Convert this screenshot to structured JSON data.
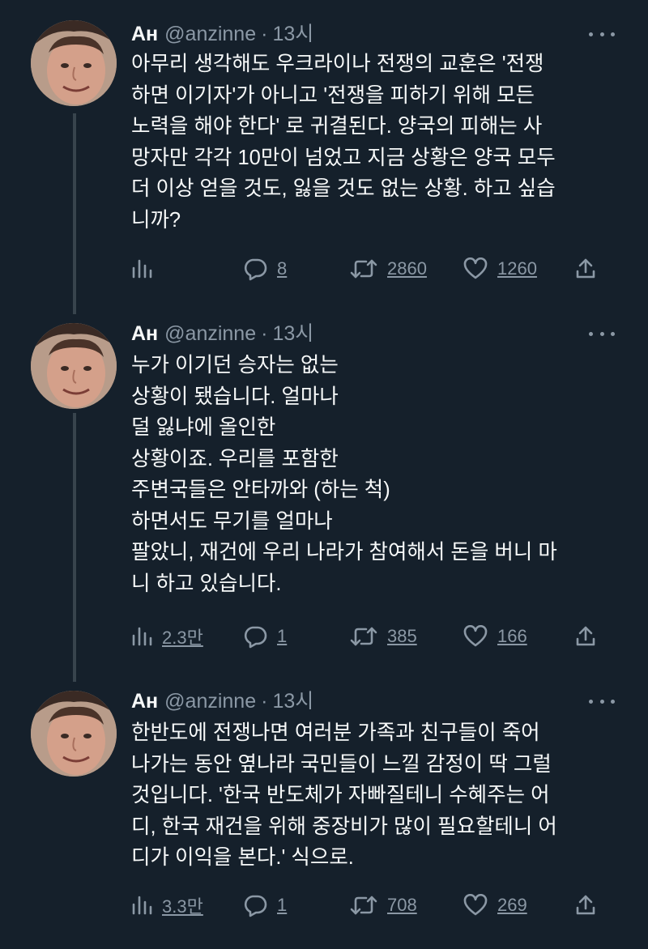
{
  "tweets": [
    {
      "name": "Ан",
      "handle": "@anzinne",
      "time": "13시",
      "text": "아무리 생각해도 우크라이나 전쟁의 교훈은 '전쟁\n하면 이기자'가 아니고 '전쟁을 피하기 위해 모든\n노력을 해야 한다' 로 귀결된다. 양국의 피해는 사\n망자만 각각 10만이 넘었고 지금 상황은 양국 모두\n더 이상 얻을 것도, 잃을 것도 없는 상황. 하고 싶습\n니까?",
      "views": "",
      "replies": "8",
      "retweets": "2860",
      "likes": "1260"
    },
    {
      "name": "Ан",
      "handle": "@anzinne",
      "time": "13시",
      "text": "누가 이기던 승자는 없는\n상황이 됐습니다. 얼마나\n덜 잃냐에 올인한\n상황이죠. 우리를 포함한\n주변국들은 안타까와 (하는 척)\n하면서도 무기를 얼마나\n팔았니, 재건에 우리 나라가 참여해서 돈을 버니 마\n니 하고 있습니다.",
      "views": "2.3만",
      "replies": "1",
      "retweets": "385",
      "likes": "166"
    },
    {
      "name": "Ан",
      "handle": "@anzinne",
      "time": "13시",
      "text": "한반도에 전쟁나면 여러분 가족과 친구들이 죽어\n나가는 동안 옆나라 국민들이 느낄 감정이 딱 그럴\n것입니다. '한국 반도체가 자빠질테니 수혜주는 어\n디, 한국 재건을 위해 중장비가 많이 필요할테니 어\n디가 이익을 본다.' 식으로.",
      "views": "3.3만",
      "replies": "1",
      "retweets": "708",
      "likes": "269"
    }
  ],
  "icons": {
    "views": "bar-chart-icon",
    "reply": "speech-bubble-icon",
    "retweet": "retweet-icon",
    "like": "heart-icon",
    "share": "share-icon",
    "more": "more-dots-icon"
  },
  "colors": {
    "background": "#15202b",
    "text": "#f7f9f9",
    "muted": "#8b98a5",
    "thread_line": "#38444d"
  }
}
